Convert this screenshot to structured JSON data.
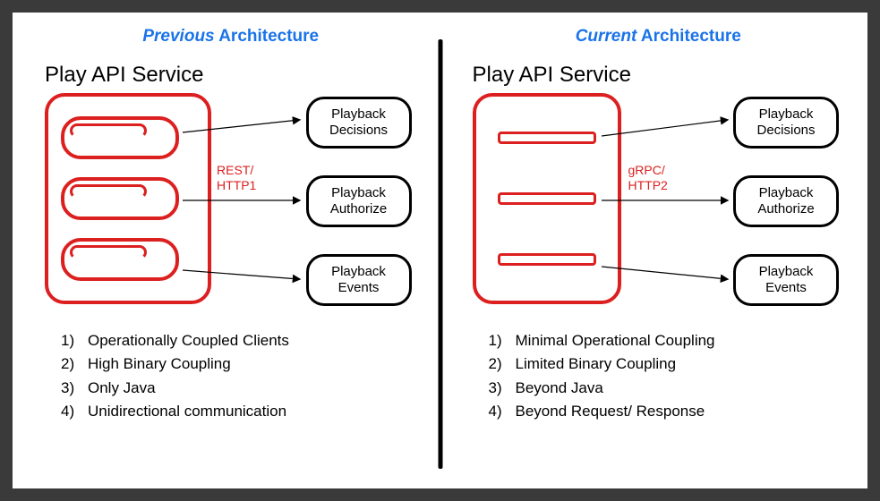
{
  "left": {
    "title_emph": "Previous",
    "title_rest": " Architecture",
    "service_title": "Play API Service",
    "protocol": "REST/\nHTTP1",
    "services": {
      "a": "Playback\nDecisions",
      "b": "Playback\nAuthorize",
      "c": "Playback\nEvents"
    },
    "bullets": {
      "n1": "1)",
      "b1": "Operationally Coupled Clients",
      "n2": "2)",
      "b2": "High Binary Coupling",
      "n3": "3)",
      "b3": "Only Java",
      "n4": "4)",
      "b4": "Unidirectional communication"
    }
  },
  "right": {
    "title_emph": "Current",
    "title_rest": " Architecture",
    "service_title": "Play API Service",
    "protocol": "gRPC/\nHTTP2",
    "services": {
      "a": "Playback\nDecisions",
      "b": "Playback\nAuthorize",
      "c": "Playback\nEvents"
    },
    "bullets": {
      "n1": "1)",
      "b1": "Minimal Operational Coupling",
      "n2": "2)",
      "b2": "Limited Binary Coupling",
      "n3": "3)",
      "b3": "Beyond Java",
      "n4": "4)",
      "b4": "Beyond Request/ Response"
    }
  }
}
